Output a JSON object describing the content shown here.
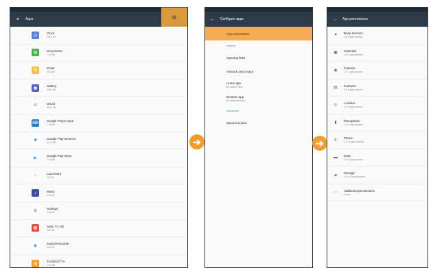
{
  "screen1": {
    "title": "Apps",
    "apps": [
      {
        "name": "Clock",
        "size": "24.00 KB",
        "icon": "clock-icon",
        "color": "#5b7fd1",
        "glyph": "◷"
      },
      {
        "name": "Documents",
        "size": "7.14 MB",
        "icon": "documents-icon",
        "color": "#4caf50",
        "glyph": "▤"
      },
      {
        "name": "Email",
        "size": "4.61 MB",
        "icon": "email-icon",
        "color": "#f2c14e",
        "glyph": "✉"
      },
      {
        "name": "Gallery",
        "size": "24.00 KB",
        "icon": "gallery-icon",
        "color": "#5a5fc0",
        "glyph": "▣"
      },
      {
        "name": "Gmail",
        "size": "28.00 KB",
        "icon": "gmail-icon",
        "color": "#ffffff",
        "glyph": "M"
      },
      {
        "name": "Google Pinyin Input",
        "size": "7.75 MB",
        "icon": "keyboard-icon",
        "color": "#2a7fc6",
        "glyph": "⌨"
      },
      {
        "name": "Google Play services",
        "size": "41.11 MB",
        "icon": "play-services-icon",
        "color": "#ffffff",
        "glyph": "✱"
      },
      {
        "name": "Google Play Store",
        "size": "1.44 MB",
        "icon": "play-store-icon",
        "color": "#ffffff",
        "glyph": "▶"
      },
      {
        "name": "Launcher3",
        "size": "120 KB",
        "icon": "launcher-icon",
        "color": "#ffffff",
        "glyph": "⌂"
      },
      {
        "name": "Music",
        "size": "6.00 KB",
        "icon": "music-icon",
        "color": "#3b4ea3",
        "glyph": "♪"
      },
      {
        "name": "Settings",
        "size": "4.00 KB",
        "icon": "settings-icon",
        "color": "#ffffff",
        "glyph": "⚙"
      },
      {
        "name": "Sohu TV HD",
        "size": "6.00 KB",
        "icon": "sohu-tv-icon",
        "color": "#e74c3c",
        "glyph": "▦"
      },
      {
        "name": "Sound Recorder",
        "size": "8.00 KB",
        "icon": "sound-recorder-icon",
        "color": "#ffffff",
        "glyph": "◉"
      },
      {
        "name": "TAOBAOTTA",
        "size": "1.00 MB",
        "icon": "taobao-icon",
        "color": "#f39c2d",
        "glyph": "淘"
      }
    ]
  },
  "screen2": {
    "title": "Configure apps",
    "items": [
      {
        "type": "item",
        "label": "App permissions",
        "sub": "",
        "highlight": true
      },
      {
        "type": "header",
        "label": "Default"
      },
      {
        "type": "item",
        "label": "Opening links",
        "sub": ""
      },
      {
        "type": "item",
        "label": "Assist & voice input",
        "sub": ""
      },
      {
        "type": "item",
        "label": "Home app",
        "sub": "No default Home"
      },
      {
        "type": "item",
        "label": "Browser app",
        "sub": "No default Browser"
      },
      {
        "type": "header",
        "label": "Advanced"
      },
      {
        "type": "item",
        "label": "Special access",
        "sub": ""
      }
    ]
  },
  "screen3": {
    "title": "App permissions",
    "permissions": [
      {
        "name": "Body Sensors",
        "sub": "0 of 0 apps allowed",
        "icon": "heart-icon",
        "glyph": "♥"
      },
      {
        "name": "Calendar",
        "sub": "2 of 2 apps allowed",
        "icon": "calendar-icon",
        "glyph": "▣"
      },
      {
        "name": "Camera",
        "sub": "2 of 7 apps allowed",
        "icon": "camera-icon",
        "glyph": "◉"
      },
      {
        "name": "Contacts",
        "sub": "3 of 8 apps allowed",
        "icon": "contacts-icon",
        "glyph": "▤"
      },
      {
        "name": "Location",
        "sub": "2 of 5 apps allowed",
        "icon": "location-icon",
        "glyph": "⚲"
      },
      {
        "name": "Microphone",
        "sub": "2 of 6 apps allowed",
        "icon": "microphone-icon",
        "glyph": "▮"
      },
      {
        "name": "Phone",
        "sub": "4 of 10 apps allowed",
        "icon": "phone-icon",
        "glyph": "✆"
      },
      {
        "name": "SMS",
        "sub": "3 of 5 apps allowed",
        "icon": "sms-icon",
        "glyph": "▬"
      },
      {
        "name": "Storage",
        "sub": "10 of 13 apps allowed",
        "icon": "folder-icon",
        "glyph": "▰"
      },
      {
        "name": "Additional permissions",
        "sub": "4 more",
        "icon": "more-icon",
        "glyph": "⋯"
      }
    ]
  },
  "arrow_glyph": "➔",
  "colors": {
    "toolbar": "#2e3b48",
    "accent": "#f39c2d",
    "highlight": "#f4ab52"
  }
}
